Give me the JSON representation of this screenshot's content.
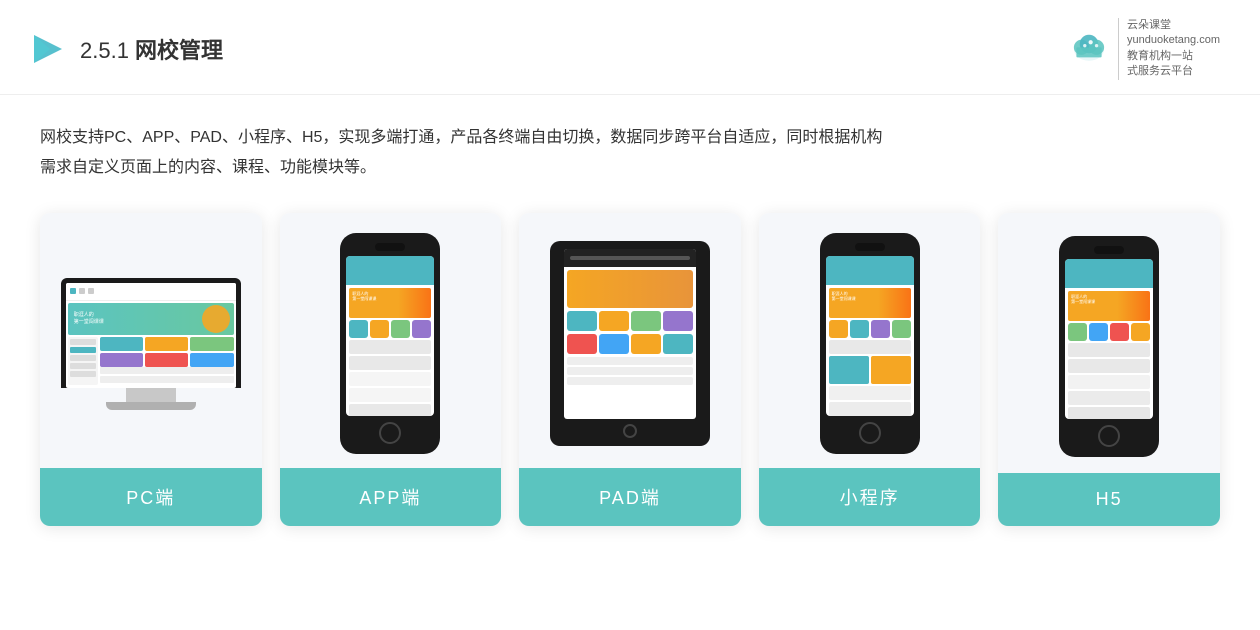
{
  "header": {
    "section_number": "2.5.1",
    "title_light": "2.5.1 ",
    "title_bold": "网校管理",
    "brand_name": "云朵课堂",
    "brand_url": "yunduoketang.com",
    "brand_tagline1": "教育机构一站",
    "brand_tagline2": "式服务云平台"
  },
  "description": {
    "line1": "网校支持PC、APP、PAD、小程序、H5，实现多端打通，产品各终端自由切换，数据同步跨平台自适应，同时根据机构",
    "line2": "需求自定义页面上的内容、课程、功能模块等。"
  },
  "cards": [
    {
      "id": "pc",
      "label": "PC端",
      "type": "pc"
    },
    {
      "id": "app",
      "label": "APP端",
      "type": "phone"
    },
    {
      "id": "pad",
      "label": "PAD端",
      "type": "pad"
    },
    {
      "id": "miniprogram",
      "label": "小程序",
      "type": "phone"
    },
    {
      "id": "h5",
      "label": "H5",
      "type": "phone"
    }
  ],
  "card_label_bg": "#5bc4bf",
  "card_label_color": "#ffffff"
}
